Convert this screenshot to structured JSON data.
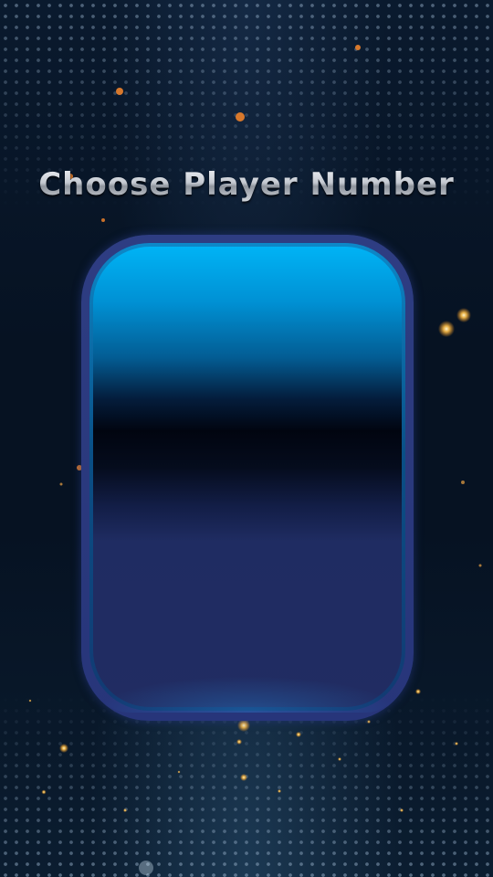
{
  "screen": {
    "title": "Choose Player Number"
  },
  "colors": {
    "background": "#061222",
    "panel_frame": "#2e3d82",
    "panel_top": "#00b3f5",
    "panel_bottom": "#212c62",
    "sparkle": "#ffb347"
  }
}
